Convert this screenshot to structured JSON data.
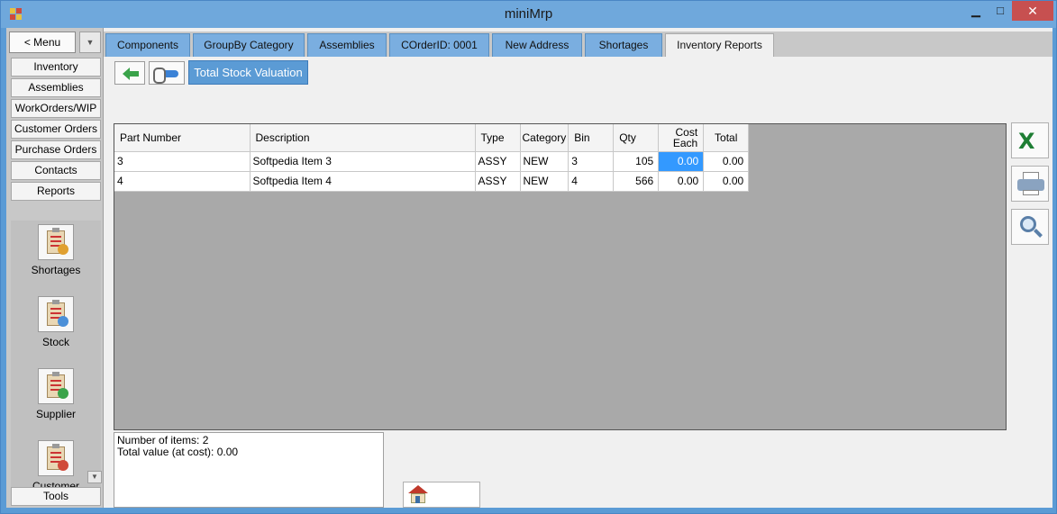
{
  "window": {
    "title": "miniMrp",
    "minimize": "▁",
    "maximize": "□",
    "close": "✕"
  },
  "nav": {
    "menu_label": "< Menu",
    "menu_drop": "▼",
    "items": [
      "Inventory",
      "Assemblies",
      "WorkOrders/WIP",
      "Customer Orders",
      "Purchase Orders",
      "Contacts",
      "Reports"
    ],
    "reports": [
      {
        "label": "Shortages",
        "icon": "shortages-report-icon",
        "badge": "#e0a030"
      },
      {
        "label": "Stock",
        "icon": "stock-report-icon",
        "badge": "#4a8fd8"
      },
      {
        "label": "Supplier",
        "icon": "supplier-report-icon",
        "badge": "#3aa34a"
      },
      {
        "label": "Customer",
        "icon": "customer-report-icon",
        "badge": "#d04a3a"
      }
    ],
    "scroll_down": "▼",
    "tools_label": "Tools"
  },
  "tabs": [
    "Components",
    "GroupBy Category",
    "Assemblies",
    "COrderID: 0001",
    "New Address",
    "Shortages",
    "Inventory Reports"
  ],
  "toolbar": {
    "report_title": "Total Stock Valuation"
  },
  "grid": {
    "columns": [
      "Part Number",
      "Description",
      "Type",
      "Category",
      "Bin",
      "Qty",
      "Cost Each",
      "Total"
    ],
    "rows": [
      [
        "3",
        "Softpedia Item 3",
        "ASSY",
        "NEW",
        "3",
        "105",
        "0.00",
        "0.00"
      ],
      [
        "4",
        "Softpedia Item 4",
        "ASSY",
        "NEW",
        "4",
        "566",
        "0.00",
        "0.00"
      ]
    ]
  },
  "summary": {
    "line1": "Number of items: 2",
    "line2": "Total value (at cost): 0.00"
  },
  "side_buttons": {
    "excel_glyph": "X"
  }
}
